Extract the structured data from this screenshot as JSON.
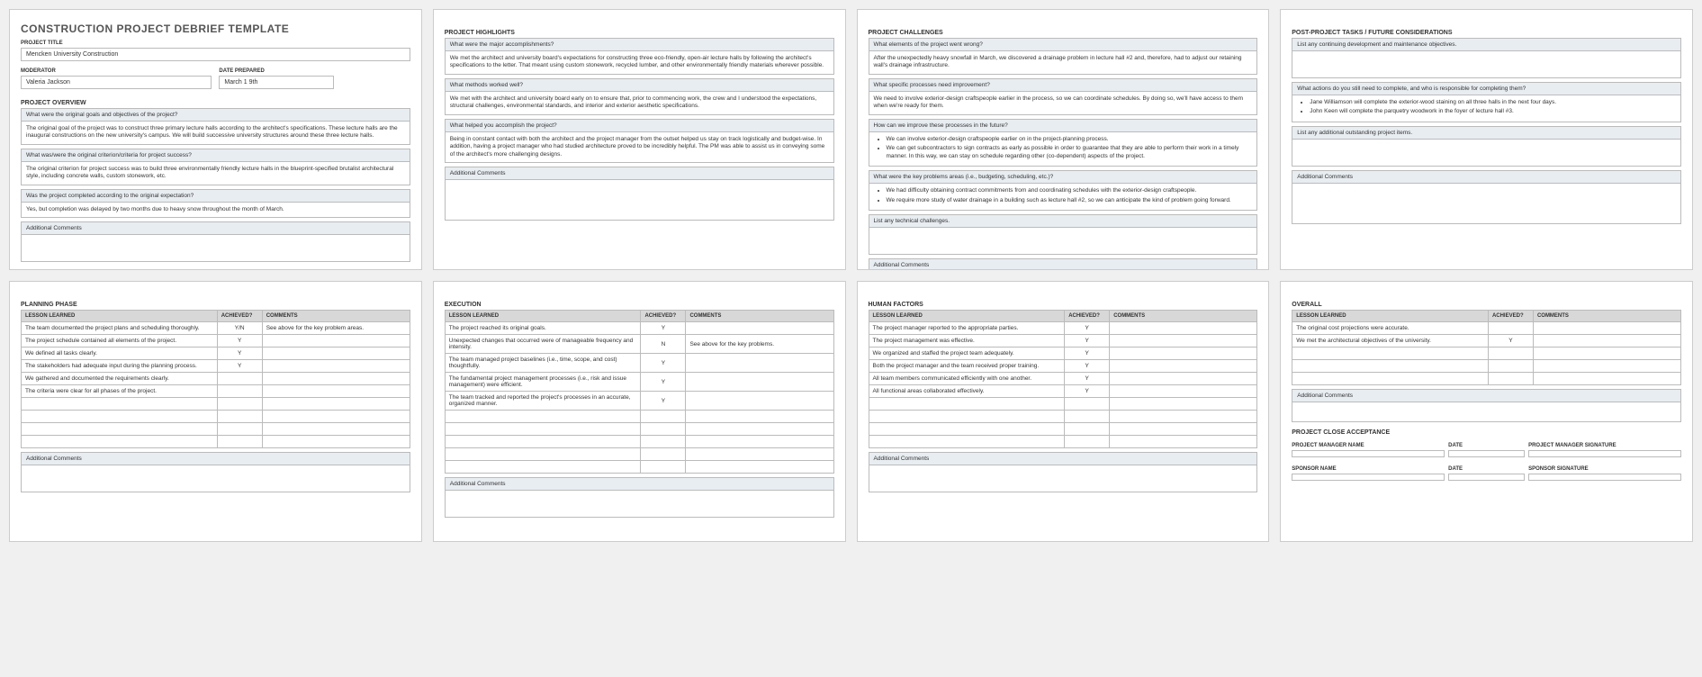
{
  "page1": {
    "main_title": "CONSTRUCTION PROJECT DEBRIEF TEMPLATE",
    "project_title_label": "PROJECT TITLE",
    "project_title": "Mencken University Construction",
    "moderator_label": "MODERATOR",
    "moderator": "Valeria Jackson",
    "date_label": "DATE PREPARED",
    "date": "March 1 9th",
    "overview_head": "PROJECT OVERVIEW",
    "q1": "What were the original goals and objectives of the project?",
    "a1": "The original goal of the project was to construct three primary lecture halls according to the architect's specifications. These lecture halls are the inaugural constructions on the new university's campus. We will build successive university structures around these three lecture halls.",
    "q2": "What was/were the original criterion/criteria for project success?",
    "a2": "The original criterion for project success was to build three environmentally friendly lecture halls in the blueprint-specified brutalist architectural style, including concrete walls, custom stonework, etc.",
    "q3": "Was the project completed according to the original expectation?",
    "a3": "Yes, but completion was delayed by two months due to heavy snow throughout the month of March.",
    "addl": "Additional Comments"
  },
  "page2": {
    "head": "PROJECT HIGHLIGHTS",
    "q1": "What were the major accomplishments?",
    "a1": "We met the architect and university board's expectations for constructing three eco-friendly, open-air lecture halls by following the architect's specifications to the letter. That meant using custom stonework, recycled lumber, and other environmentally friendly materials wherever possible.",
    "q2": "What methods worked well?",
    "a2": "We met with the architect and university board early on to ensure that, prior to commencing work, the crew and I understood the expectations, structural challenges, environmental standards, and interior and exterior aesthetic specifications.",
    "q3": "What helped you accomplish the project?",
    "a3": "Being in constant contact with both the architect and the project manager from the outset helped us stay on track logistically and budget-wise. In addition, having a project manager who had studied architecture proved to be incredibly helpful. The PM was able to assist us in conveying some of the architect's more challenging designs.",
    "addl": "Additional Comments"
  },
  "page3": {
    "head": "PROJECT CHALLENGES",
    "q1": "What elements of the project went wrong?",
    "a1": "After the unexpectedly heavy snowfall in March, we discovered a drainage problem in lecture hall #2 and, therefore, had to adjust our retaining wall's drainage infrastructure.",
    "q2": "What specific processes need improvement?",
    "a2": "We need to involve exterior-design craftspeople earlier in the process, so we can coordinate schedules. By doing so, we'll have access to them when we're ready for them.",
    "q3": "How can we improve these processes in the future?",
    "a3_b1": "We can involve exterior-design craftspeople earlier on in the project-planning process.",
    "a3_b2": "We can get subcontractors to sign contracts as early as possible in order to guarantee that they are able to perform their work in a timely manner. In this way, we can stay on schedule regarding other (co-dependent) aspects of the project.",
    "q4": "What were the key problems areas (i.e., budgeting, scheduling, etc.)?",
    "a4_b1": "We had difficulty obtaining contract commitments from and coordinating schedules with the exterior-design craftspeople.",
    "a4_b2": "We require more study of water drainage in a building such as lecture hall #2, so we can anticipate the kind of problem going forward.",
    "q5": "List any technical challenges.",
    "addl": "Additional Comments"
  },
  "page4": {
    "head": "POST-PROJECT TASKS / FUTURE CONSIDERATIONS",
    "q1": "List any continuing development and maintenance objectives.",
    "q2": "What actions do you still need to complete, and who is responsible for completing them?",
    "a2_b1": "Jane Williamson will complete the exterior-wood staining on all three halls in the next four days.",
    "a2_b2": "John Keen will complete the parquetry woodwork in the foyer of lecture hall #3.",
    "q3": "List any additional outstanding project items.",
    "addl": "Additional Comments"
  },
  "page5": {
    "head": "PLANNING PHASE",
    "th1": "LESSON LEARNED",
    "th2": "ACHIEVED?",
    "th3": "COMMENTS",
    "r1l": "The team documented the project plans and scheduling thoroughly.",
    "r1a": "Y/N",
    "r1c": "See above for the key problem areas.",
    "r2l": "The project schedule contained all elements of the project.",
    "r2a": "Y",
    "r3l": "We defined all tasks clearly.",
    "r3a": "Y",
    "r4l": "The stakeholders had adequate input during the planning process.",
    "r4a": "Y",
    "r5l": "We gathered and documented the requirements clearly.",
    "r6l": "The criteria were clear for all phases of the project.",
    "addl": "Additional Comments"
  },
  "page6": {
    "head": "EXECUTION",
    "th1": "LESSON LEARNED",
    "th2": "ACHIEVED?",
    "th3": "COMMENTS",
    "r1l": "The project reached its original goals.",
    "r1a": "Y",
    "r2l": "Unexpected changes that occurred were of manageable frequency and intensity.",
    "r2a": "N",
    "r2c": "See above for the key problems.",
    "r3l": "The team managed project baselines (i.e., time, scope, and cost) thoughtfully.",
    "r3a": "Y",
    "r4l": "The fundamental project management processes (i.e., risk and issue management) were efficient.",
    "r4a": "Y",
    "r5l": "The team tracked and reported the project's processes in an accurate, organized manner.",
    "r5a": "Y",
    "addl": "Additional Comments"
  },
  "page7": {
    "head": "HUMAN FACTORS",
    "th1": "LESSON LEARNED",
    "th2": "ACHIEVED?",
    "th3": "COMMENTS",
    "r1l": "The project manager reported to the appropriate parties.",
    "r1a": "Y",
    "r2l": "The project management was effective.",
    "r2a": "Y",
    "r3l": "We organized and staffed the project team adequately.",
    "r3a": "Y",
    "r4l": "Both the project manager and the team received proper training.",
    "r4a": "Y",
    "r5l": "All team members communicated efficiently with one another.",
    "r5a": "Y",
    "r6l": "All functional areas collaborated effectively.",
    "r6a": "Y",
    "addl": "Additional Comments"
  },
  "page8": {
    "head": "OVERALL",
    "th1": "LESSON LEARNED",
    "th2": "ACHIEVED?",
    "th3": "COMMENTS",
    "r1l": "The original cost projections were accurate.",
    "r2l": "We met the architectural objectives of the university.",
    "r2a": "Y",
    "addl": "Additional Comments",
    "close_head": "PROJECT CLOSE ACCEPTANCE",
    "pm_name": "PROJECT MANAGER NAME",
    "date": "DATE",
    "pm_sig": "PROJECT MANAGER SIGNATURE",
    "sp_name": "SPONSOR NAME",
    "sp_sig": "SPONSOR SIGNATURE"
  }
}
